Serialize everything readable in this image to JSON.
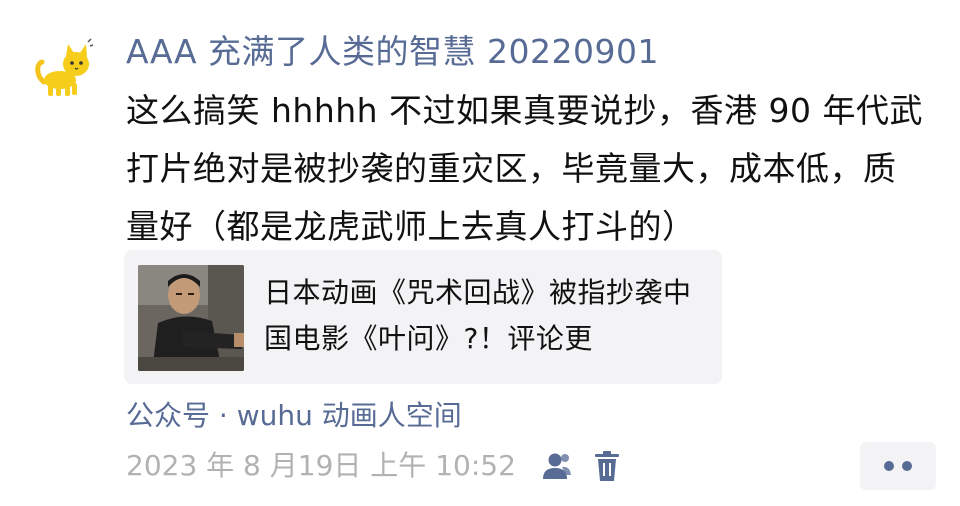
{
  "post": {
    "nickname": "AAA 充满了人类的智慧 20220901",
    "text": "这么搞笑 hhhhh 不过如果真要说抄，香港 90 年代武打片绝对是被抄袭的重灾区，毕竟量大，成本低，质量好（都是龙虎武师上去真人打斗的）",
    "link_card": {
      "title": "日本动画《咒术回战》被指抄袭中国电影《叶问》?！评论更"
    },
    "source": "公众号 · wuhu 动画人空间",
    "timestamp": "2023 年 8 月19日 上午 10:52",
    "icons": {
      "avatar": "yellow-cat-avatar",
      "visibility": "people-icon",
      "delete": "trash-icon",
      "more": "more-dots-icon"
    },
    "colors": {
      "link_blue": "#576b95",
      "timestamp_gray": "#b2b2b2",
      "card_bg": "#f3f3f5",
      "text": "#111111"
    }
  }
}
